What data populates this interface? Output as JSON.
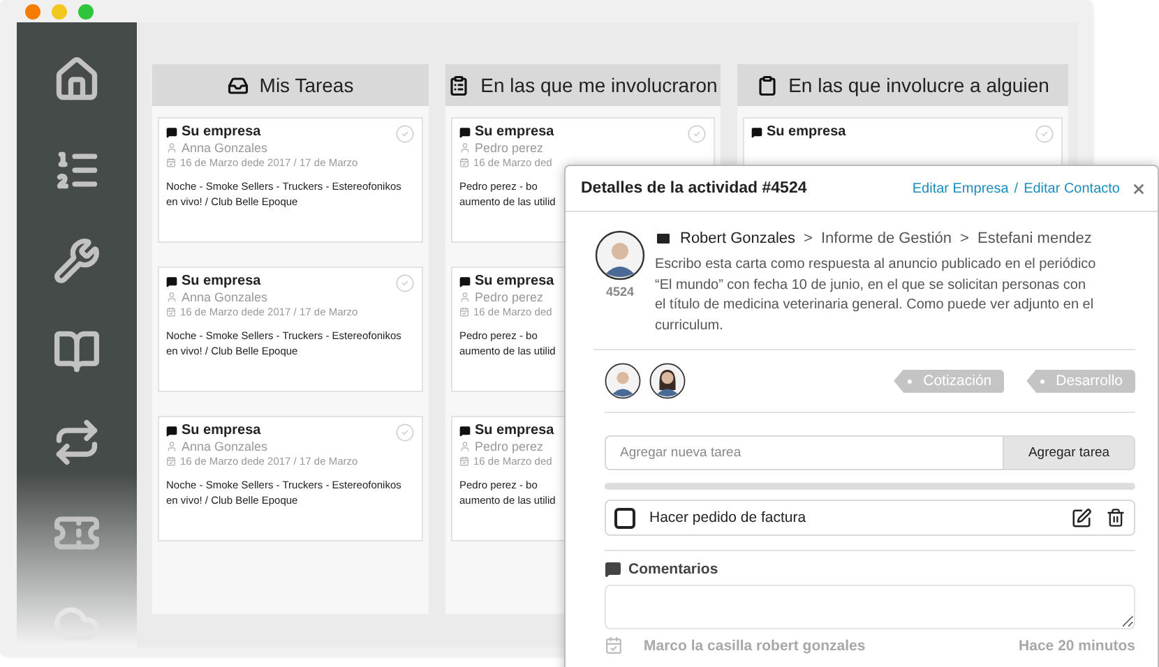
{
  "columns": [
    {
      "title": "Mis Tareas",
      "cards": [
        {
          "company": "Su empresa",
          "person": "Anna Gonzales",
          "date": "16 de Marzo dede 2017 / 17 de Marzo",
          "lines": [
            "Noche - Smoke Sellers - Truckers - Estereofonikos",
            "en vivo! / Club Belle Epoque"
          ],
          "completed": false
        },
        {
          "company": "Su empresa",
          "person": "Anna Gonzales",
          "date": "16 de Marzo dede 2017 / 17 de Marzo",
          "lines": [
            "Noche - Smoke Sellers - Truckers - Estereofonikos",
            "en vivo! / Club Belle Epoque"
          ],
          "completed": false
        },
        {
          "company": "Su empresa",
          "person": "Anna Gonzales",
          "date": "16 de Marzo dede 2017 / 17 de Marzo",
          "lines": [
            "Noche - Smoke Sellers - Truckers - Estereofonikos",
            "en vivo! / Club Belle Epoque"
          ],
          "completed": false
        }
      ]
    },
    {
      "title": "En las que me involucraron",
      "cards": [
        {
          "company": "Su empresa",
          "person": "Pedro perez",
          "date": "16 de Marzo ded",
          "lines": [
            "Pedro  perez  -  bo",
            "aumento de las utilid"
          ],
          "completed": false
        },
        {
          "company": "Su empresa",
          "person": "Pedro perez",
          "date": "16 de Marzo ded",
          "lines": [
            "Pedro  perez  -  bo",
            "aumento de las utilid"
          ]
        },
        {
          "company": "Su empresa",
          "person": "Pedro perez",
          "date": "16 de Marzo ded",
          "lines": [
            "Pedro  perez  -  bo",
            "aumento de las utilid"
          ]
        }
      ]
    },
    {
      "title": "En las que involucre a alguien",
      "cards": [
        {
          "company": "Su empresa",
          "completed": false
        }
      ]
    }
  ],
  "modal": {
    "title": "Detalles de la actividad #4524",
    "links": [
      "Editar Empresa",
      "Editar Contacto"
    ],
    "link_separator": "/",
    "activity": {
      "id": "4524",
      "from": "Robert Gonzales",
      "path": [
        "Informe de Gestión",
        "Estefani mendez"
      ],
      "separator": ">",
      "body": "Escribo esta carta como respuesta al anuncio publicado en el periódico “El mundo” con fecha 10 de junio, en el que se solicitan personas con el título de medicina veterinaria general. Como puede ver adjunto en el curriculum."
    },
    "participants": [
      {
        "kind": "man"
      },
      {
        "kind": "woman"
      }
    ],
    "tags": [
      "Cotización",
      "Desarrollo"
    ],
    "new_task": {
      "placeholder": "Agregar nueva tarea",
      "button": "Agregar tarea"
    },
    "progress": {
      "level": 0
    },
    "tasks": [
      {
        "label": "Hacer pedido de factura",
        "checked": false
      }
    ],
    "comments": {
      "heading": "Comentarios"
    },
    "log": [
      {
        "text": "Marco la casilla robert gonzales",
        "time": "Hace 20 minutos",
        "checked": true
      }
    ]
  }
}
